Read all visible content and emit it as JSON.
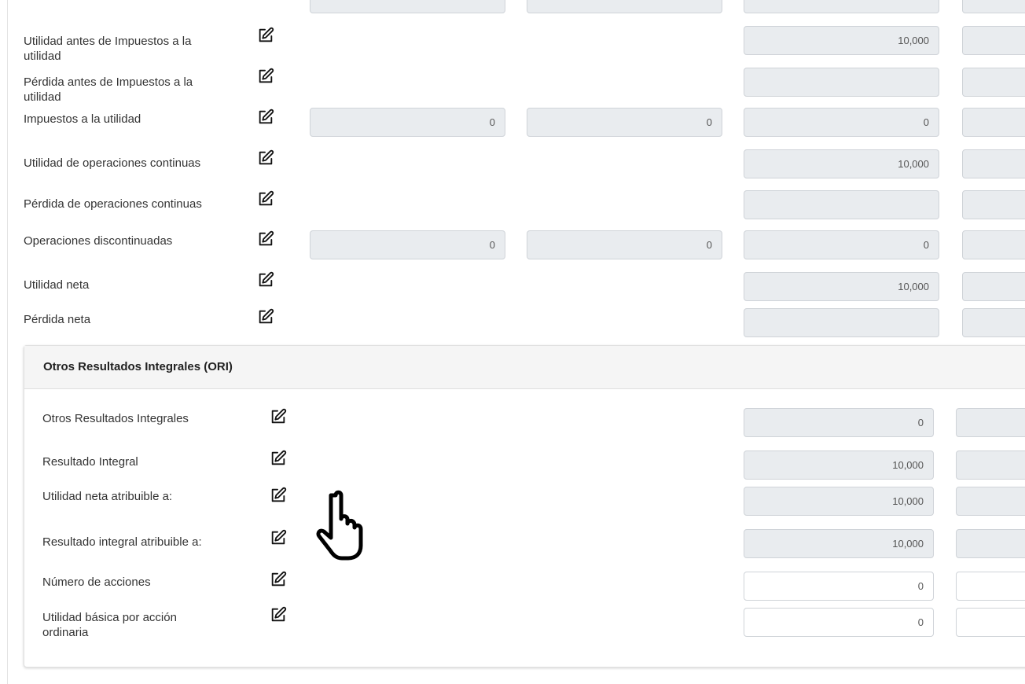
{
  "rows": [
    {
      "label": "Utilidad antes de Impuestos a la utilidad",
      "c1": null,
      "c2": null,
      "c3": "10,000"
    },
    {
      "label": "Pérdida antes de Impuestos a la utilidad",
      "c1": null,
      "c2": null,
      "c3": ""
    },
    {
      "label": "Impuestos a la utilidad",
      "c1": "0",
      "c2": "0",
      "c3": "0"
    },
    {
      "label": "Utilidad de operaciones continuas",
      "c1": null,
      "c2": null,
      "c3": "10,000"
    },
    {
      "label": "Pérdida de operaciones continuas",
      "c1": null,
      "c2": null,
      "c3": ""
    },
    {
      "label": "Operaciones discontinuadas",
      "c1": "0",
      "c2": "0",
      "c3": "0"
    },
    {
      "label": "Utilidad neta",
      "c1": null,
      "c2": null,
      "c3": "10,000"
    },
    {
      "label": "Pérdida neta",
      "c1": null,
      "c2": null,
      "c3": ""
    }
  ],
  "ori": {
    "title": "Otros Resultados Integrales (ORI)",
    "rows": [
      {
        "label": "Otros Resultados Integrales",
        "value": "0",
        "editable": false
      },
      {
        "label": "Resultado Integral",
        "value": "10,000",
        "editable": false
      },
      {
        "label": "Utilidad neta atribuible a:",
        "value": "10,000",
        "editable": false
      },
      {
        "label": "Resultado integral atribuible a:",
        "value": "10,000",
        "editable": false
      },
      {
        "label": "Número de acciones",
        "value": "0",
        "editable": true
      },
      {
        "label": "Utilidad básica por acción ordinaria",
        "value": "0",
        "editable": true
      }
    ]
  },
  "icons": {
    "edit": "edit-pencil-icon",
    "cursor": "hand-pointer-cursor-icon"
  },
  "colors": {
    "field_disabled_bg": "#e9ecef",
    "field_border": "#cfd3d8",
    "card_header_bg": "#f5f5f5",
    "text": "#333333"
  }
}
